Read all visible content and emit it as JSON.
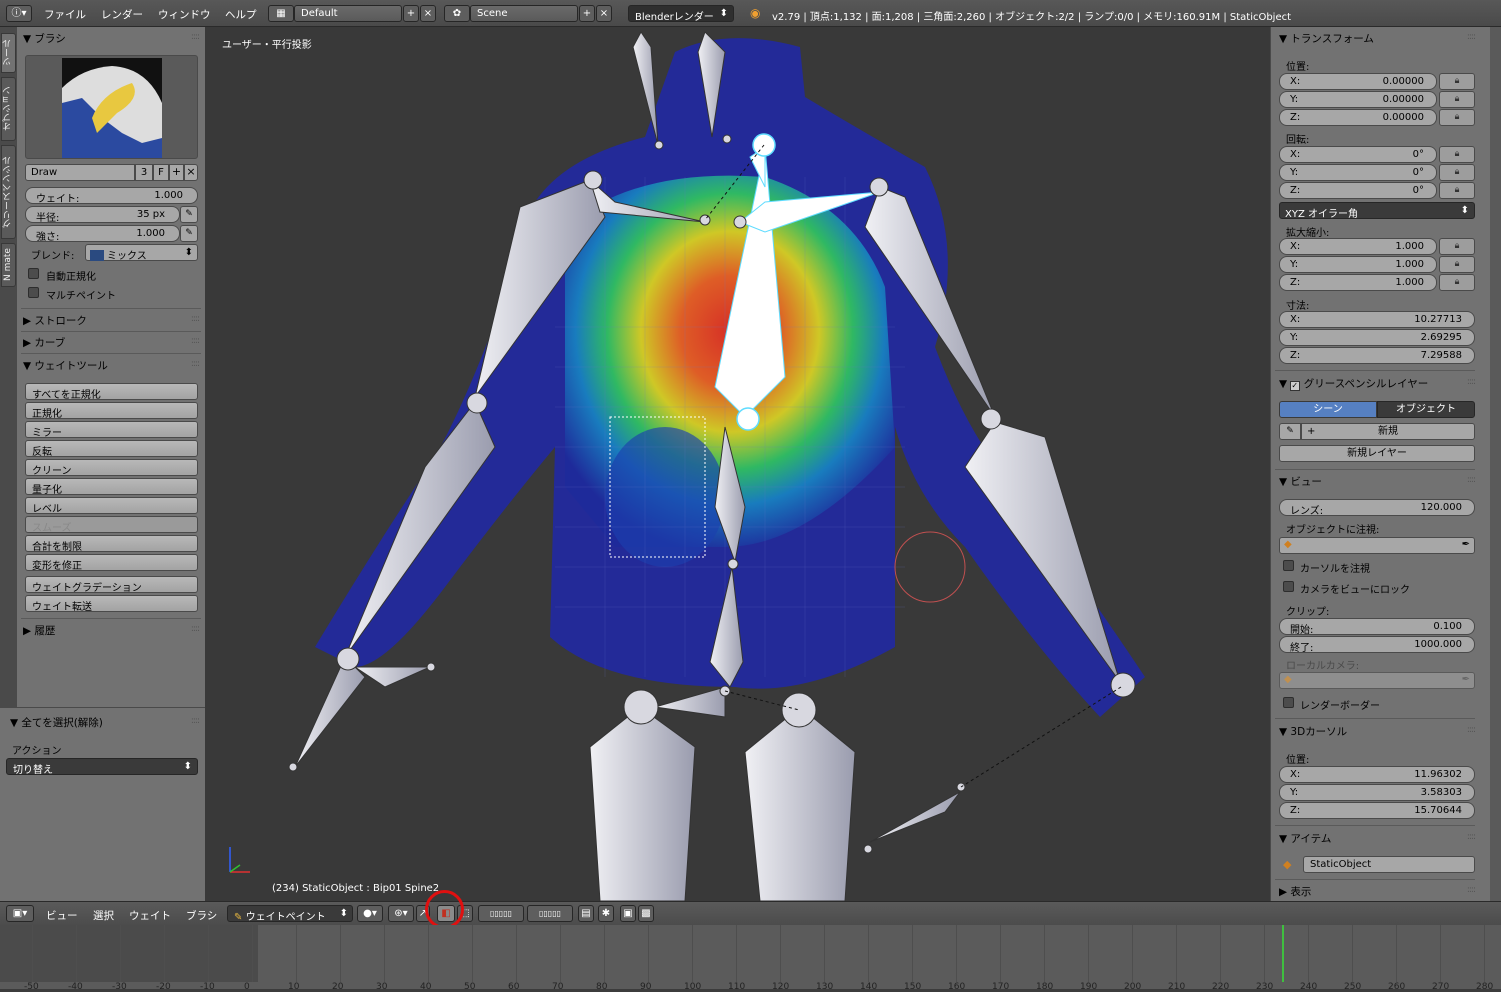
{
  "menubar": {
    "items": [
      "ファイル",
      "レンダー",
      "ウィンドウ",
      "ヘルプ"
    ],
    "layout": "Default",
    "scene": "Scene",
    "engine": "Blenderレンダー",
    "status": "v2.79 | 頂点:1,132 | 面:1,208 | 三角面:2,260 | オブジェクト:2/2 | ランプ:0/0 | メモリ:160.91M | StaticObject"
  },
  "vtabs": [
    "ツール",
    "オプション",
    "グリースペンシル",
    "N mate"
  ],
  "brush": {
    "header": "ブラシ",
    "name": "Draw",
    "users": "3",
    "fake": "F",
    "weight_label": "ウェイト:",
    "weight": "1.000",
    "radius_label": "半径:",
    "radius": "35 px",
    "strength_label": "強さ:",
    "strength": "1.000",
    "blend_label": "ブレンド:",
    "blend": "ミックス",
    "auto_normalize": "自動正規化",
    "multipaint": "マルチペイント"
  },
  "sections": {
    "stroke": "ストローク",
    "curve": "カーブ",
    "weight_tools": "ウェイトツール",
    "history": "履歴"
  },
  "weight_tools": [
    "すべてを正規化",
    "正規化",
    "ミラー",
    "反転",
    "クリーン",
    "量子化",
    "レベル",
    "スムーズ",
    "合計を制限",
    "変形を修正",
    "ウェイトグラデーション",
    "ウェイト転送"
  ],
  "operator": {
    "header": "全てを選択(解除)",
    "action_label": "アクション",
    "action": "切り替え"
  },
  "viewport": {
    "view_label": "ユーザー・平行投影",
    "object_info": "(234) StaticObject : Bip01 Spine2"
  },
  "transform": {
    "header": "トランスフォーム",
    "location_label": "位置:",
    "location": [
      [
        "X:",
        "0.00000"
      ],
      [
        "Y:",
        "0.00000"
      ],
      [
        "Z:",
        "0.00000"
      ]
    ],
    "rotation_label": "回転:",
    "rotation": [
      [
        "X:",
        "0°"
      ],
      [
        "Y:",
        "0°"
      ],
      [
        "Z:",
        "0°"
      ]
    ],
    "rotation_mode": "XYZ オイラー角",
    "scale_label": "拡大縮小:",
    "scale": [
      [
        "X:",
        "1.000"
      ],
      [
        "Y:",
        "1.000"
      ],
      [
        "Z:",
        "1.000"
      ]
    ],
    "dimensions_label": "寸法:",
    "dimensions": [
      [
        "X:",
        "10.27713"
      ],
      [
        "Y:",
        "2.69295"
      ],
      [
        "Z:",
        "7.29588"
      ]
    ]
  },
  "grease": {
    "header": "グリースペンシルレイヤー",
    "tab_scene": "シーン",
    "tab_object": "オブジェクト",
    "new": "新規",
    "new_layer": "新規レイヤー"
  },
  "view": {
    "header": "ビュー",
    "lens_label": "レンズ:",
    "lens": "120.000",
    "lock_object_label": "オブジェクトに注視:",
    "lock_cursor": "カーソルを注視",
    "lock_camera": "カメラをビューにロック",
    "clip_label": "クリップ:",
    "clip_start_label": "開始:",
    "clip_start": "0.100",
    "clip_end_label": "終了:",
    "clip_end": "1000.000",
    "local_camera_label": "ローカルカメラ:",
    "render_border": "レンダーボーダー"
  },
  "cursor3d": {
    "header": "3Dカーソル",
    "location_label": "位置:",
    "location": [
      [
        "X:",
        "11.96302"
      ],
      [
        "Y:",
        "3.58303"
      ],
      [
        "Z:",
        "15.70644"
      ]
    ]
  },
  "item": {
    "header": "アイテム",
    "name": "StaticObject"
  },
  "display_header": "表示",
  "header3d": {
    "menus": [
      "ビュー",
      "選択",
      "ウェイト",
      "ブラシ"
    ],
    "mode": "ウェイトペイント"
  },
  "timeline": {
    "ticks": [
      "-50",
      "-40",
      "-30",
      "-20",
      "-10",
      "0",
      "10",
      "20",
      "30",
      "40",
      "50",
      "60",
      "70",
      "80",
      "90",
      "100",
      "110",
      "120",
      "130",
      "140",
      "150",
      "160",
      "170",
      "180",
      "190",
      "200",
      "210",
      "220",
      "230",
      "240",
      "250",
      "260",
      "270",
      "280"
    ],
    "current_frame": 234
  },
  "colors": {
    "panel": "#727272",
    "viewport": "#393939",
    "selected_tab": "#5680c2",
    "frame_marker": "#3fbf3f",
    "highlight_circle": "#e01010"
  }
}
